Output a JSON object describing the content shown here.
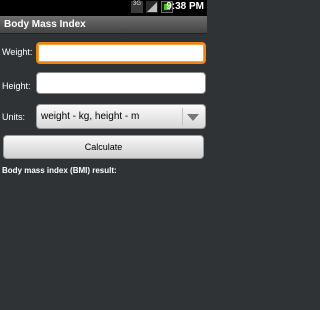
{
  "status_bar": {
    "time": "9:38 PM",
    "network_label": "3G",
    "icons": [
      "3g-icon",
      "signal-icon",
      "battery-icon"
    ]
  },
  "app": {
    "title": "Body Mass Index"
  },
  "form": {
    "weight_label": "Weight:",
    "weight_value": "",
    "height_label": "Height:",
    "height_value": "",
    "units_label": "Units:",
    "units_selected": "weight - kg, height - m",
    "calculate_label": "Calculate",
    "result_label": "Body mass index (BMI) result:"
  },
  "colors": {
    "focus_accent": "#f0820f",
    "background": "#2f3335",
    "battery_fill": "#49c61a"
  }
}
